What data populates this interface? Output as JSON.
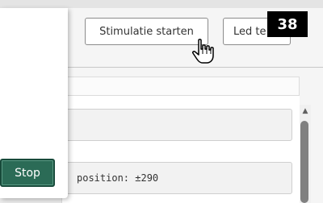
{
  "toolbar": {
    "start_stimulation_label": "Stimulatie starten",
    "led_test_label": "Led te"
  },
  "badge": {
    "number": "38"
  },
  "log": {
    "rows": [
      {
        "text": ""
      },
      {
        "text": "position: ±290"
      }
    ]
  },
  "popup": {
    "stop_label": "Stop"
  },
  "colors": {
    "stop_button": "#2b6b56",
    "badge": "#000000"
  },
  "icons": {
    "cursor": "hand-pointer-icon",
    "scroll_up": "triangle-up-icon"
  }
}
